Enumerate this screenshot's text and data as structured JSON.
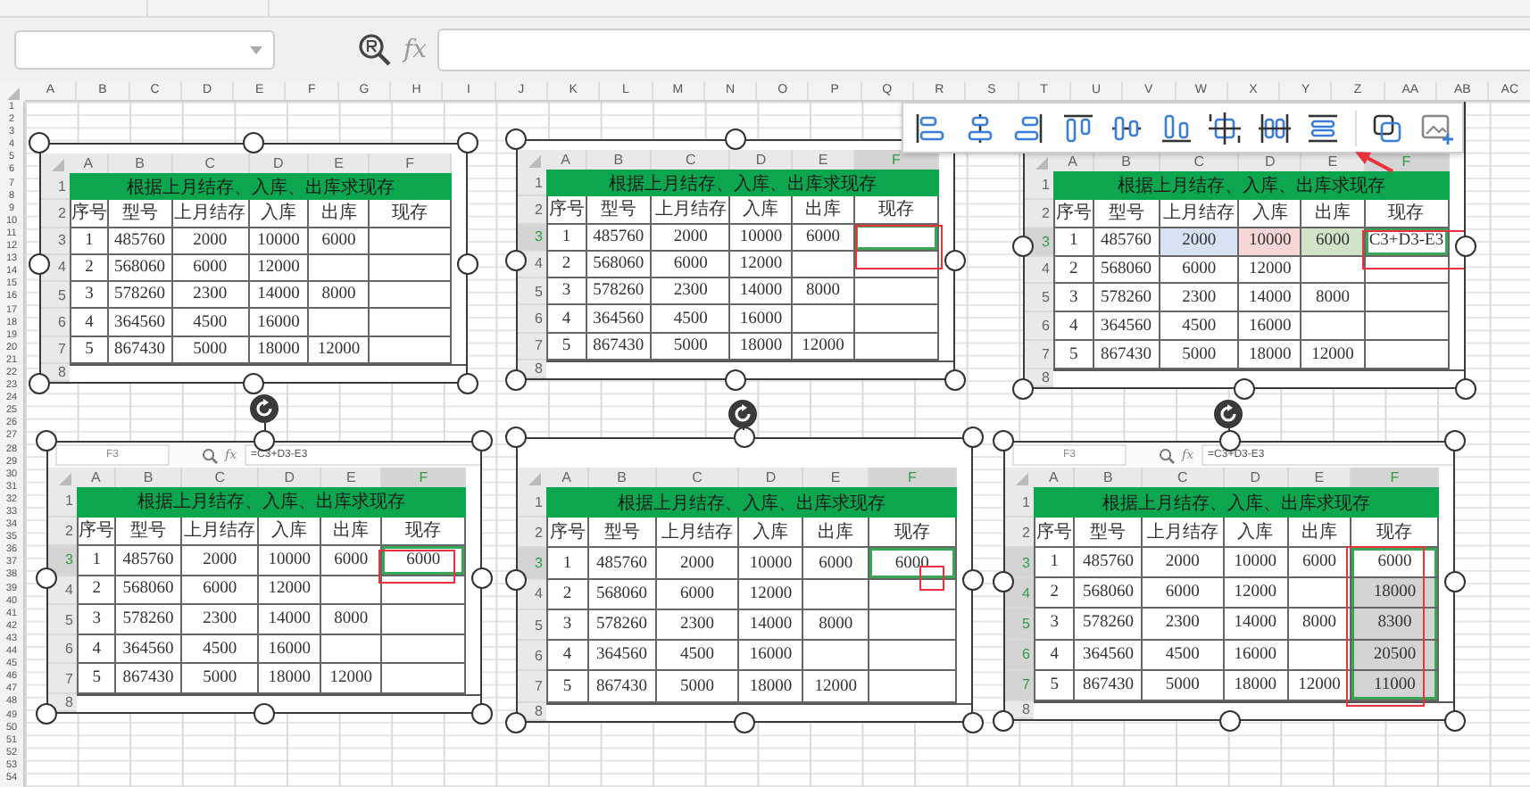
{
  "formula_bar": {
    "fx": "fx"
  },
  "sheet": {
    "columns": [
      "A",
      "B",
      "C",
      "D",
      "E",
      "F",
      "G",
      "H",
      "I",
      "J",
      "K",
      "L",
      "M",
      "N",
      "O",
      "P",
      "Q",
      "R",
      "S",
      "T",
      "U",
      "V",
      "W",
      "X",
      "Y",
      "Z",
      "AA",
      "AB",
      "AC"
    ],
    "rows": [
      "1",
      "2",
      "3",
      "4",
      "5",
      "6",
      "7",
      "8",
      "9",
      "10",
      "11",
      "12",
      "13",
      "14",
      "15",
      "16",
      "17",
      "18",
      "19",
      "20",
      "21",
      "22",
      "23",
      "24",
      "25",
      "26",
      "27",
      "28",
      "29",
      "30",
      "31",
      "32",
      "33",
      "34",
      "35",
      "36",
      "37",
      "38",
      "39",
      "40",
      "41",
      "42",
      "43",
      "44",
      "45",
      "46",
      "47",
      "48",
      "49",
      "50",
      "51",
      "52",
      "53",
      "54"
    ]
  },
  "panels": [
    {
      "columns": [
        "A",
        "B",
        "C",
        "D",
        "E",
        "F"
      ],
      "row_numbers": [
        "1",
        "2",
        "3",
        "4",
        "5",
        "6",
        "7",
        "8"
      ],
      "title": "根据上月结存、入库、出库求现存",
      "headers": [
        "序号",
        "型号",
        "上月结存",
        "入库",
        "出库",
        "现存"
      ],
      "marked": false,
      "rows": [
        {
          "cells": [
            {
              "text": "1"
            },
            {
              "text": "485760"
            },
            {
              "text": "2000"
            },
            {
              "text": "10000"
            },
            {
              "text": "6000"
            }
          ],
          "result": {
            "selected": false
          }
        },
        {
          "cells": [
            {
              "text": "2"
            },
            {
              "text": "568060"
            },
            {
              "text": "6000"
            },
            {
              "text": "12000"
            },
            {}
          ],
          "result": {
            "selected": false
          }
        },
        {
          "cells": [
            {
              "text": "3"
            },
            {
              "text": "578260"
            },
            {
              "text": "2300"
            },
            {
              "text": "14000"
            },
            {
              "text": "8000"
            }
          ],
          "result": {
            "selected": false
          }
        },
        {
          "cells": [
            {
              "text": "4"
            },
            {
              "text": "364560"
            },
            {
              "text": "4500"
            },
            {
              "text": "16000"
            },
            {}
          ],
          "result": {
            "selected": false
          }
        },
        {
          "cells": [
            {
              "text": "5"
            },
            {
              "text": "867430"
            },
            {
              "text": "5000"
            },
            {
              "text": "18000"
            },
            {
              "text": "12000"
            }
          ],
          "result": {
            "selected": false
          }
        }
      ]
    },
    {
      "columns": [
        "A",
        "B",
        "C",
        "D",
        "E",
        "F"
      ],
      "row_numbers": [
        "1",
        "2",
        "3",
        "4",
        "5",
        "6",
        "7",
        "8"
      ],
      "title": "根据上月结存、入库、出库求现存",
      "headers": [
        "序号",
        "型号",
        "上月结存",
        "入库",
        "出库",
        "现存"
      ],
      "marked": true,
      "rows": [
        {
          "cells": [
            {
              "text": "1"
            },
            {
              "text": "485760"
            },
            {
              "text": "2000"
            },
            {
              "text": "10000"
            },
            {
              "text": "6000"
            }
          ],
          "result": {
            "selected": true
          }
        },
        {
          "cells": [
            {
              "text": "2"
            },
            {
              "text": "568060"
            },
            {
              "text": "6000"
            },
            {
              "text": "12000"
            },
            {}
          ],
          "result": {
            "selected": false
          }
        },
        {
          "cells": [
            {
              "text": "3"
            },
            {
              "text": "578260"
            },
            {
              "text": "2300"
            },
            {
              "text": "14000"
            },
            {
              "text": "8000"
            }
          ],
          "result": {
            "selected": false
          }
        },
        {
          "cells": [
            {
              "text": "4"
            },
            {
              "text": "364560"
            },
            {
              "text": "4500"
            },
            {
              "text": "16000"
            },
            {}
          ],
          "result": {
            "selected": false
          }
        },
        {
          "cells": [
            {
              "text": "5"
            },
            {
              "text": "867430"
            },
            {
              "text": "5000"
            },
            {
              "text": "18000"
            },
            {
              "text": "12000"
            }
          ],
          "result": {
            "selected": false
          }
        }
      ]
    },
    {
      "columns": [
        "A",
        "B",
        "C",
        "D",
        "E",
        "F"
      ],
      "row_numbers": [
        "1",
        "2",
        "3",
        "4",
        "5",
        "6",
        "7",
        "8"
      ],
      "title": "根据上月结存、入库、出库求现存",
      "headers": [
        "序号",
        "型号",
        "上月结存",
        "入库",
        "出库",
        "现存"
      ],
      "marked": true,
      "rows": [
        {
          "cells": [
            {
              "text": "1"
            },
            {
              "text": "485760"
            },
            {
              "text": "2000",
              "color": "#d9e1f5"
            },
            {
              "text": "10000",
              "color": "#f6d6d6"
            },
            {
              "text": "6000",
              "color": "#d3e3c9"
            }
          ],
          "result": {
            "text": "C3+D3-E3",
            "selected": true
          }
        },
        {
          "cells": [
            {
              "text": "2"
            },
            {
              "text": "568060"
            },
            {
              "text": "6000"
            },
            {
              "text": "12000"
            },
            {}
          ],
          "result": {
            "selected": false
          }
        },
        {
          "cells": [
            {
              "text": "3"
            },
            {
              "text": "578260"
            },
            {
              "text": "2300"
            },
            {
              "text": "14000"
            },
            {
              "text": "8000"
            }
          ],
          "result": {
            "selected": false
          }
        },
        {
          "cells": [
            {
              "text": "4"
            },
            {
              "text": "364560"
            },
            {
              "text": "4500"
            },
            {
              "text": "16000"
            },
            {}
          ],
          "result": {
            "selected": false
          }
        },
        {
          "cells": [
            {
              "text": "5"
            },
            {
              "text": "867430"
            },
            {
              "text": "5000"
            },
            {
              "text": "18000"
            },
            {
              "text": "12000"
            }
          ],
          "result": {
            "selected": false
          }
        }
      ]
    },
    {
      "formula_bar": {
        "cell": "F3",
        "fx": "fx",
        "formula": "=C3+D3-E3"
      },
      "columns": [
        "A",
        "B",
        "C",
        "D",
        "E",
        "F"
      ],
      "row_numbers": [
        "1",
        "2",
        "3",
        "4",
        "5",
        "6",
        "7",
        "8"
      ],
      "title": "根据上月结存、入库、出库求现存",
      "headers": [
        "序号",
        "型号",
        "上月结存",
        "入库",
        "出库",
        "现存"
      ],
      "marked": true,
      "rows": [
        {
          "cells": [
            {
              "text": "1"
            },
            {
              "text": "485760"
            },
            {
              "text": "2000"
            },
            {
              "text": "10000"
            },
            {
              "text": "6000"
            }
          ],
          "result": {
            "text": "6000",
            "selected": true
          }
        },
        {
          "cells": [
            {
              "text": "2"
            },
            {
              "text": "568060"
            },
            {
              "text": "6000"
            },
            {
              "text": "12000"
            },
            {}
          ],
          "result": {
            "selected": false
          }
        },
        {
          "cells": [
            {
              "text": "3"
            },
            {
              "text": "578260"
            },
            {
              "text": "2300"
            },
            {
              "text": "14000"
            },
            {
              "text": "8000"
            }
          ],
          "result": {
            "selected": false
          }
        },
        {
          "cells": [
            {
              "text": "4"
            },
            {
              "text": "364560"
            },
            {
              "text": "4500"
            },
            {
              "text": "16000"
            },
            {}
          ],
          "result": {
            "selected": false
          }
        },
        {
          "cells": [
            {
              "text": "5"
            },
            {
              "text": "867430"
            },
            {
              "text": "5000"
            },
            {
              "text": "18000"
            },
            {
              "text": "12000"
            }
          ],
          "result": {
            "selected": false
          }
        }
      ]
    },
    {
      "columns": [
        "A",
        "B",
        "C",
        "D",
        "E",
        "F"
      ],
      "row_numbers": [
        "1",
        "2",
        "3",
        "4",
        "5",
        "6",
        "7",
        "8"
      ],
      "title": "根据上月结存、入库、出库求现存",
      "headers": [
        "序号",
        "型号",
        "上月结存",
        "入库",
        "出库",
        "现存"
      ],
      "marked": true,
      "rows": [
        {
          "cells": [
            {
              "text": "1"
            },
            {
              "text": "485760"
            },
            {
              "text": "2000"
            },
            {
              "text": "10000"
            },
            {
              "text": "6000"
            }
          ],
          "result": {
            "text": "6000",
            "selected": true
          }
        },
        {
          "cells": [
            {
              "text": "2"
            },
            {
              "text": "568060"
            },
            {
              "text": "6000"
            },
            {
              "text": "12000"
            },
            {}
          ],
          "result": {
            "selected": false
          }
        },
        {
          "cells": [
            {
              "text": "3"
            },
            {
              "text": "578260"
            },
            {
              "text": "2300"
            },
            {
              "text": "14000"
            },
            {
              "text": "8000"
            }
          ],
          "result": {
            "selected": false
          }
        },
        {
          "cells": [
            {
              "text": "4"
            },
            {
              "text": "364560"
            },
            {
              "text": "4500"
            },
            {
              "text": "16000"
            },
            {}
          ],
          "result": {
            "selected": false
          }
        },
        {
          "cells": [
            {
              "text": "5"
            },
            {
              "text": "867430"
            },
            {
              "text": "5000"
            },
            {
              "text": "18000"
            },
            {
              "text": "12000"
            }
          ],
          "result": {
            "selected": false
          }
        }
      ]
    },
    {
      "formula_bar": {
        "cell": "F3",
        "fx": "fx",
        "formula": "=C3+D3-E3"
      },
      "columns": [
        "A",
        "B",
        "C",
        "D",
        "E",
        "F"
      ],
      "row_numbers": [
        "1",
        "2",
        "3",
        "4",
        "5",
        "6",
        "7",
        "8"
      ],
      "title": "根据上月结存、入库、出库求现存",
      "headers": [
        "序号",
        "型号",
        "上月结存",
        "入库",
        "出库",
        "现存"
      ],
      "marked": true,
      "rows": [
        {
          "cells": [
            {
              "text": "1"
            },
            {
              "text": "485760"
            },
            {
              "text": "2000"
            },
            {
              "text": "10000"
            },
            {
              "text": "6000"
            }
          ],
          "result": {
            "text": "6000",
            "selected": true
          }
        },
        {
          "cells": [
            {
              "text": "2"
            },
            {
              "text": "568060"
            },
            {
              "text": "6000"
            },
            {
              "text": "12000"
            },
            {}
          ],
          "result": {
            "text": "18000",
            "selected": true
          }
        },
        {
          "cells": [
            {
              "text": "3"
            },
            {
              "text": "578260"
            },
            {
              "text": "2300"
            },
            {
              "text": "14000"
            },
            {
              "text": "8000"
            }
          ],
          "result": {
            "text": "8300",
            "selected": true
          }
        },
        {
          "cells": [
            {
              "text": "4"
            },
            {
              "text": "364560"
            },
            {
              "text": "4500"
            },
            {
              "text": "16000"
            },
            {}
          ],
          "result": {
            "text": "20500",
            "selected": true
          }
        },
        {
          "cells": [
            {
              "text": "5"
            },
            {
              "text": "867430"
            },
            {
              "text": "5000"
            },
            {
              "text": "18000"
            },
            {
              "text": "12000"
            }
          ],
          "result": {
            "text": "11000",
            "selected": true
          }
        }
      ]
    }
  ]
}
